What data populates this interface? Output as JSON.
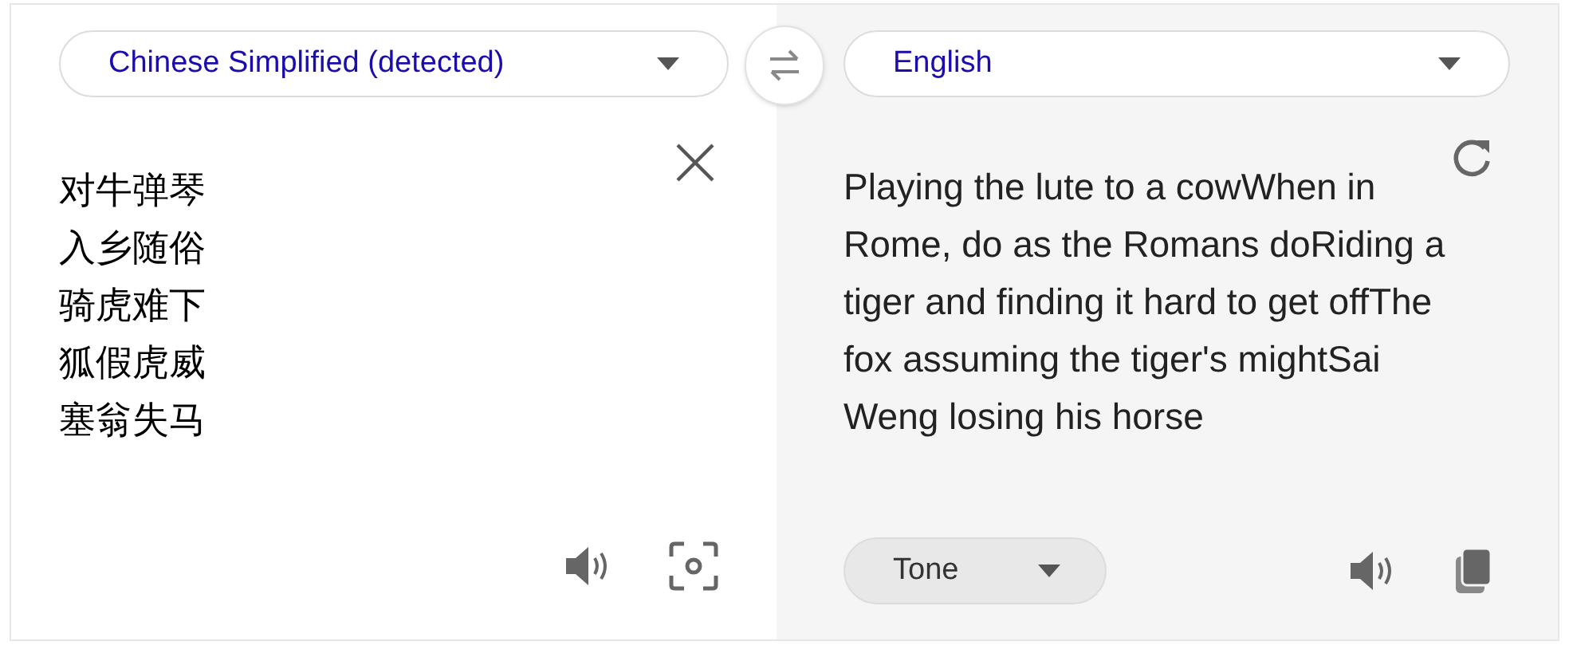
{
  "source_language": {
    "label": "Chinese Simplified (detected)"
  },
  "target_language": {
    "label": "English"
  },
  "source_lines": [
    "对牛弹琴",
    "入乡随俗",
    "骑虎难下",
    "狐假虎威",
    "塞翁失马"
  ],
  "translation": "Playing the lute to a cowWhen in Rome, do as the Romans doRiding a tiger and finding it hard to get offThe fox assuming the tiger's mightSai Weng losing his horse",
  "tone": {
    "label": "Tone"
  }
}
